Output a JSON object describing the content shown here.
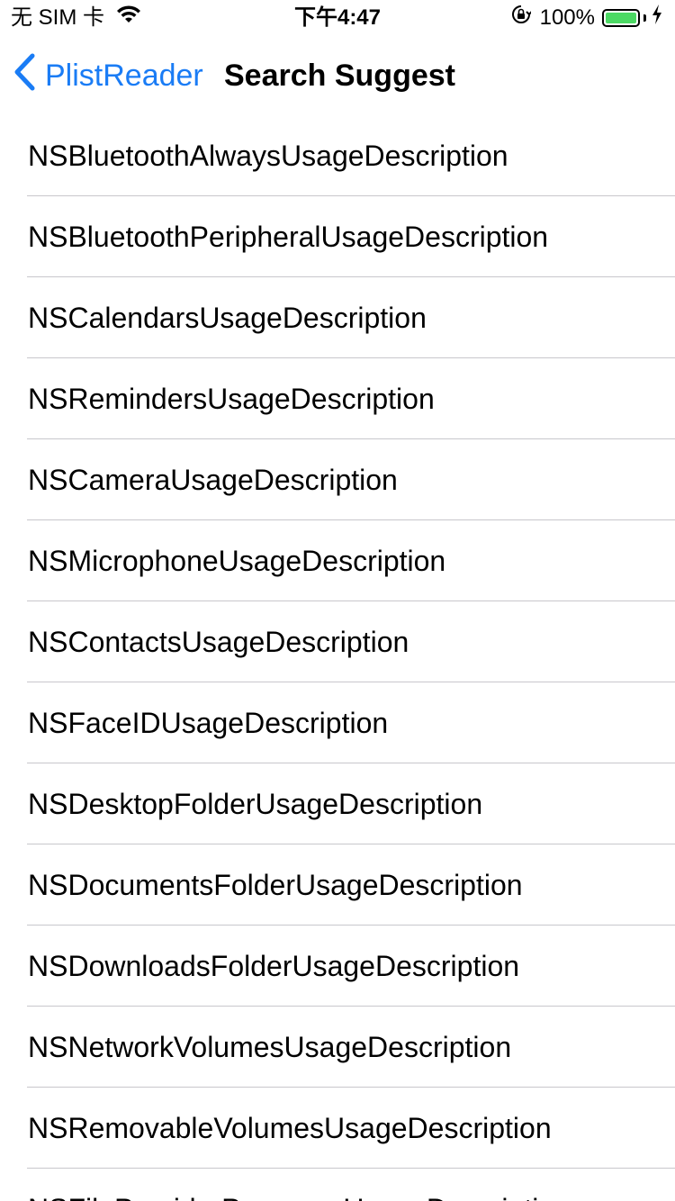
{
  "status_bar": {
    "carrier": "无 SIM 卡",
    "time": "下午4:47",
    "battery_percent": "100%",
    "battery_level": 1.0,
    "battery_color": "#4cd964",
    "icons": [
      "wifi-icon",
      "orientation-lock-icon",
      "battery-icon",
      "charging-bolt-icon"
    ]
  },
  "nav": {
    "back_label": "PlistReader",
    "title": "Search Suggest",
    "accent_color": "#1a7cf5",
    "back_icon": "chevron-left-icon"
  },
  "list": {
    "items": [
      "NSBluetoothAlwaysUsageDescription",
      "NSBluetoothPeripheralUsageDescription",
      "NSCalendarsUsageDescription",
      "NSRemindersUsageDescription",
      "NSCameraUsageDescription",
      "NSMicrophoneUsageDescription",
      "NSContactsUsageDescription",
      "NSFaceIDUsageDescription",
      "NSDesktopFolderUsageDescription",
      "NSDocumentsFolderUsageDescription",
      "NSDownloadsFolderUsageDescription",
      "NSNetworkVolumesUsageDescription",
      "NSRemovableVolumesUsageDescription",
      "NSFileProviderPresenceUsageDescription"
    ]
  }
}
